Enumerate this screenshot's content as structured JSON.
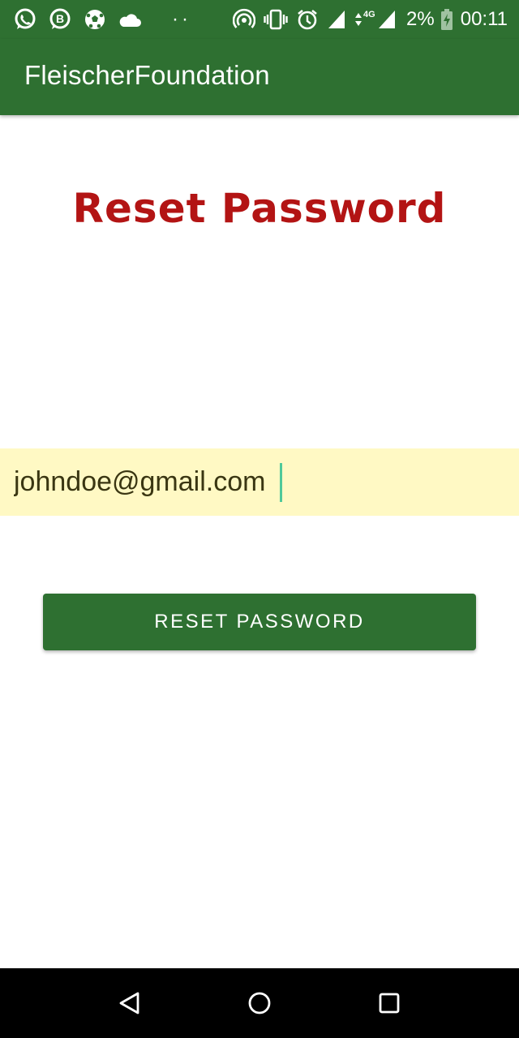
{
  "status_bar": {
    "left_icons": [
      "whatsapp-icon",
      "whatsapp-business-icon",
      "soccer-ball-icon",
      "cloud-icon"
    ],
    "dots": "··",
    "right_icons": [
      "hotspot-icon",
      "vibrate-icon",
      "alarm-icon",
      "signal-icon",
      "data-4g-icon",
      "signal-icon"
    ],
    "network_label": "4G",
    "battery_percent": "2%",
    "time": "00:11"
  },
  "app_bar": {
    "title": "FleischerFoundation",
    "color": "#2e7031"
  },
  "main": {
    "heading": "Reset Password",
    "heading_color": "#b31414",
    "email_value": "johndoe@gmail.com",
    "email_field_color": "#fff9c4",
    "reset_button_label": "RESET PASSWORD"
  },
  "nav_bar": {
    "buttons": [
      "back-icon",
      "home-icon",
      "recents-icon"
    ]
  }
}
